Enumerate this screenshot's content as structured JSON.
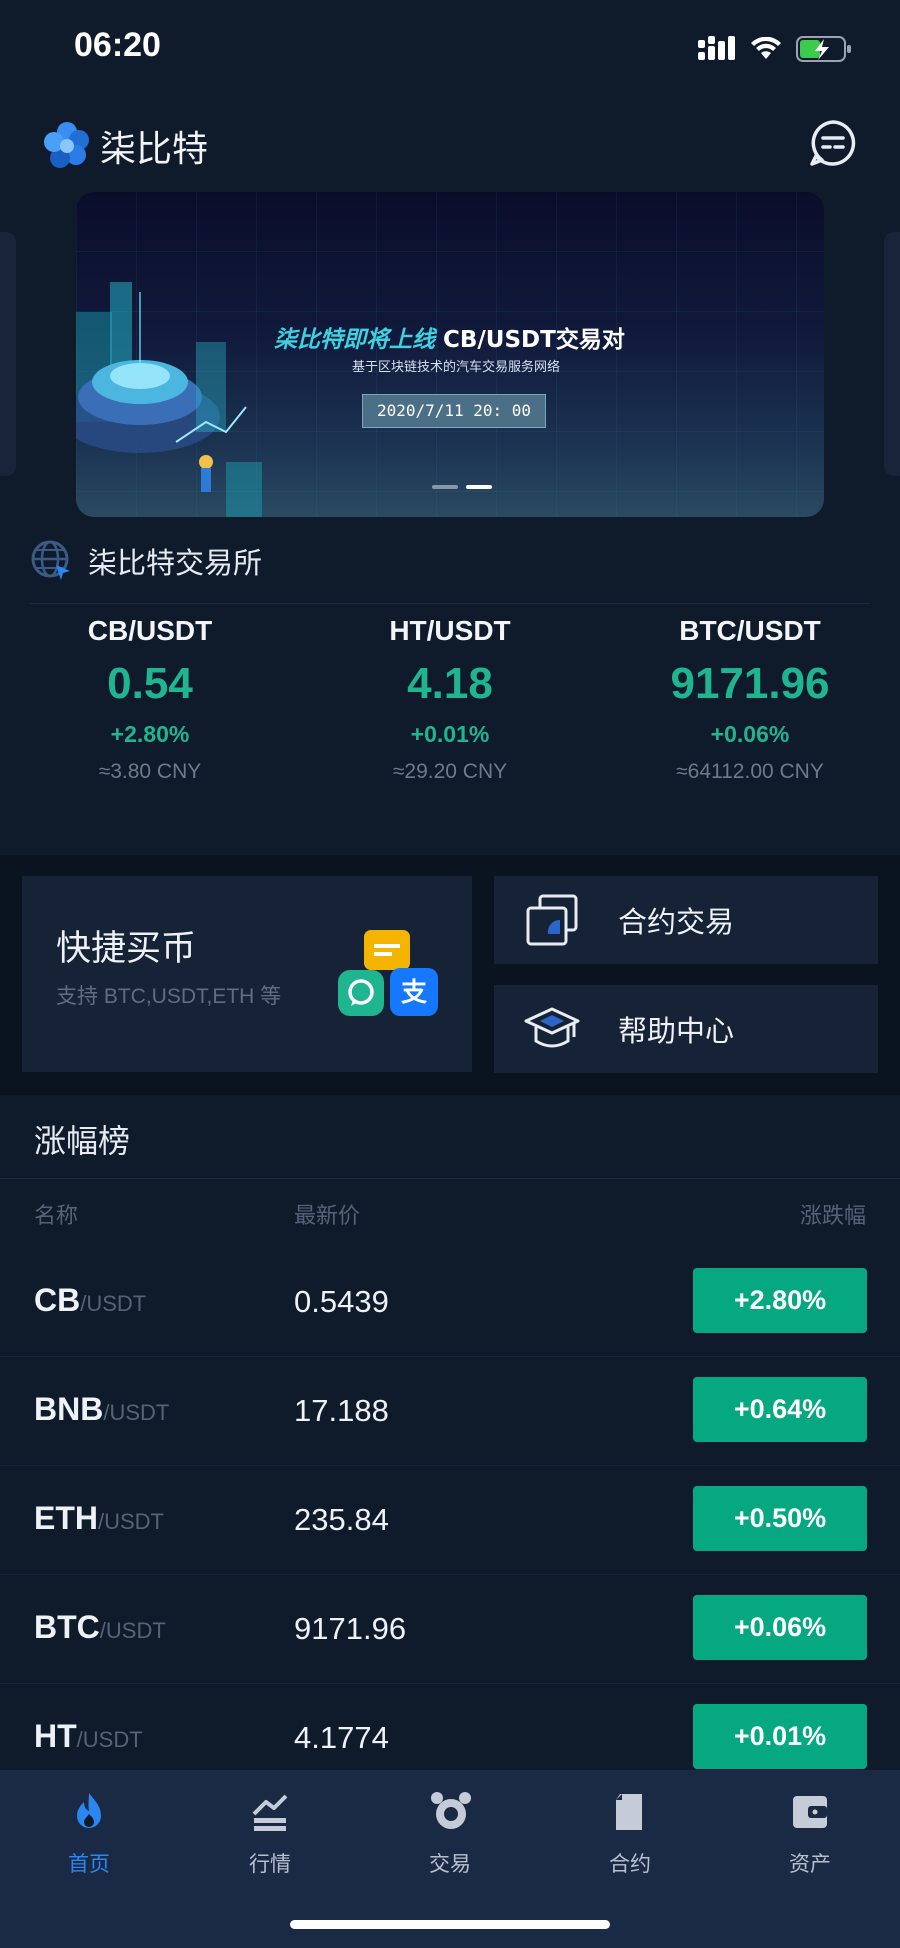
{
  "status_bar": {
    "time": "06:20"
  },
  "header": {
    "app_name": "柒比特"
  },
  "banner": {
    "title_highlight": "柒比特即将上线",
    "title_rest": "CB/USDT交易对",
    "subtitle": "基于区块链技术的汽车交易服务网络",
    "date": "2020/7/11  20: 00"
  },
  "exchange": {
    "title": "柒比特交易所"
  },
  "tickers": [
    {
      "pair": "CB/USDT",
      "price": "0.54",
      "change": "+2.80%",
      "cny": "≈3.80 CNY"
    },
    {
      "pair": "HT/USDT",
      "price": "4.18",
      "change": "+0.01%",
      "cny": "≈29.20 CNY"
    },
    {
      "pair": "BTC/USDT",
      "price": "9171.96",
      "change": "+0.06%",
      "cny": "≈64112.00 CNY"
    }
  ],
  "quick_buy": {
    "title": "快捷买币",
    "desc": "支持 BTC,USDT,ETH 等",
    "alipay_char": "支"
  },
  "shortcuts": {
    "contract": "合约交易",
    "help": "帮助中心"
  },
  "gainers": {
    "title": "涨幅榜",
    "col_name": "名称",
    "col_price": "最新价",
    "col_change": "涨跌幅",
    "rows": [
      {
        "symbol": "CB",
        "quote": "/USDT",
        "price": "0.5439",
        "change": "+2.80%"
      },
      {
        "symbol": "BNB",
        "quote": "/USDT",
        "price": "17.188",
        "change": "+0.64%"
      },
      {
        "symbol": "ETH",
        "quote": "/USDT",
        "price": "235.84",
        "change": "+0.50%"
      },
      {
        "symbol": "BTC",
        "quote": "/USDT",
        "price": "9171.96",
        "change": "+0.06%"
      },
      {
        "symbol": "HT",
        "quote": "/USDT",
        "price": "4.1774",
        "change": "+0.01%"
      }
    ]
  },
  "tabs": [
    {
      "label": "首页",
      "icon": "flame-icon",
      "active": true
    },
    {
      "label": "行情",
      "icon": "chart-icon",
      "active": false
    },
    {
      "label": "交易",
      "icon": "exchange-icon",
      "active": false
    },
    {
      "label": "合约",
      "icon": "contract-icon",
      "active": false
    },
    {
      "label": "资产",
      "icon": "wallet-icon",
      "active": false
    }
  ],
  "colors": {
    "up": "#06a882",
    "accent": "#2c86f2",
    "background": "#0f1a2b"
  }
}
